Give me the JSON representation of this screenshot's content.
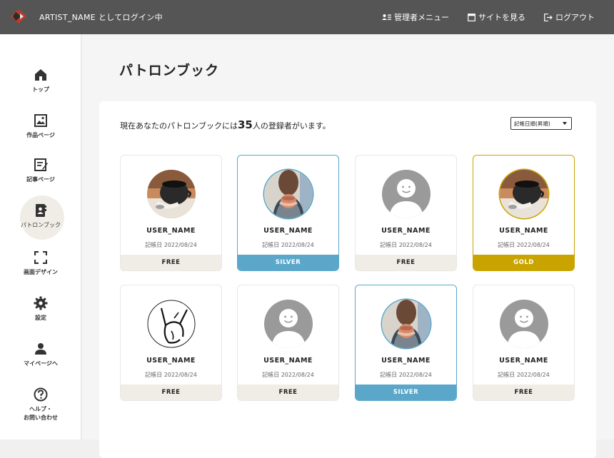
{
  "header": {
    "login_text": "ARTIST_NAME としてログイン中",
    "admin_menu": "管理者メニュー",
    "view_site": "サイトを見る",
    "logout": "ログアウト"
  },
  "sidebar": {
    "items": [
      {
        "label": "トップ",
        "icon": "home-icon"
      },
      {
        "label": "作品ページ",
        "icon": "image-icon"
      },
      {
        "label": "記事ページ",
        "icon": "edit-article-icon"
      },
      {
        "label": "パトロンブック",
        "icon": "patron-book-icon"
      },
      {
        "label": "画面デザイン",
        "icon": "fullscreen-icon"
      },
      {
        "label": "設定",
        "icon": "gear-icon"
      },
      {
        "label": "マイページへ",
        "icon": "person-icon"
      },
      {
        "label_line1": "ヘルプ・",
        "label_line2": "お問い合わせ",
        "icon": "help-icon"
      }
    ]
  },
  "main": {
    "title": "パトロンブック",
    "summary_pre": "現在あなたのパトロンブックには",
    "summary_count": "35",
    "summary_post": "人の登録者がいます。",
    "sort_selected": "記帳日順(昇順)"
  },
  "cards": [
    {
      "name": "USER_NAME",
      "date": "記帳日  2022/08/24",
      "tier": "FREE",
      "avatar": "coffee-photo"
    },
    {
      "name": "USER_NAME",
      "date": "記帳日  2022/08/24",
      "tier": "SILVER",
      "avatar": "woman-photo"
    },
    {
      "name": "USER_NAME",
      "date": "記帳日  2022/08/24",
      "tier": "FREE",
      "avatar": "default-user"
    },
    {
      "name": "USER_NAME",
      "date": "記帳日  2022/08/24",
      "tier": "GOLD",
      "avatar": "coffee-photo"
    },
    {
      "name": "USER_NAME",
      "date": "記帳日  2022/08/24",
      "tier": "FREE",
      "avatar": "sketch-drawing"
    },
    {
      "name": "USER_NAME",
      "date": "記帳日  2022/08/24",
      "tier": "FREE",
      "avatar": "default-user"
    },
    {
      "name": "USER_NAME",
      "date": "記帳日  2022/08/24",
      "tier": "SILVER",
      "avatar": "woman-photo"
    },
    {
      "name": "USER_NAME",
      "date": "記帳日  2022/08/24",
      "tier": "FREE",
      "avatar": "default-user"
    }
  ],
  "colors": {
    "header_bg": "#555555",
    "free": "#efede6",
    "silver": "#5aa7c9",
    "gold": "#c9a400"
  }
}
